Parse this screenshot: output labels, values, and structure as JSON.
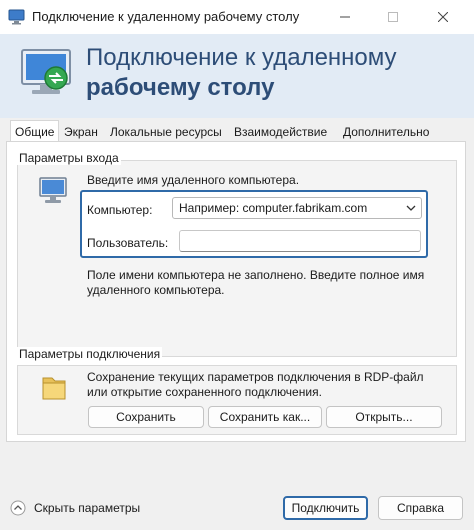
{
  "window": {
    "title": "Подключение к удаленному рабочему столу"
  },
  "header": {
    "line1": "Подключение к удаленному",
    "line2": "рабочему столу"
  },
  "tabs": [
    {
      "label": "Общие",
      "active": true
    },
    {
      "label": "Экран",
      "active": false
    },
    {
      "label": "Локальные ресурсы",
      "active": false
    },
    {
      "label": "Взаимодействие",
      "active": false
    },
    {
      "label": "Дополнительно",
      "active": false
    }
  ],
  "login": {
    "group_title": "Параметры входа",
    "hint": "Введите имя удаленного компьютера.",
    "computer_label": "Компьютер:",
    "computer_value": "Например: computer.fabrikam.com",
    "user_label": "Пользователь:",
    "user_value": "",
    "warning": "Поле имени компьютера не заполнено. Введите полное имя удаленного компьютера."
  },
  "connection": {
    "group_title": "Параметры подключения",
    "description": "Сохранение текущих параметров подключения в RDP-файл или открытие сохраненного подключения.",
    "save_label": "Сохранить",
    "save_as_label": "Сохранить как...",
    "open_label": "Открыть..."
  },
  "footer": {
    "hide_options_label": "Скрыть параметры",
    "connect_label": "Подключить",
    "help_label": "Справка"
  },
  "colors": {
    "accent": "#2f6aa8",
    "header_bg": "#e2ebf5",
    "header_text": "#2d4d77"
  }
}
